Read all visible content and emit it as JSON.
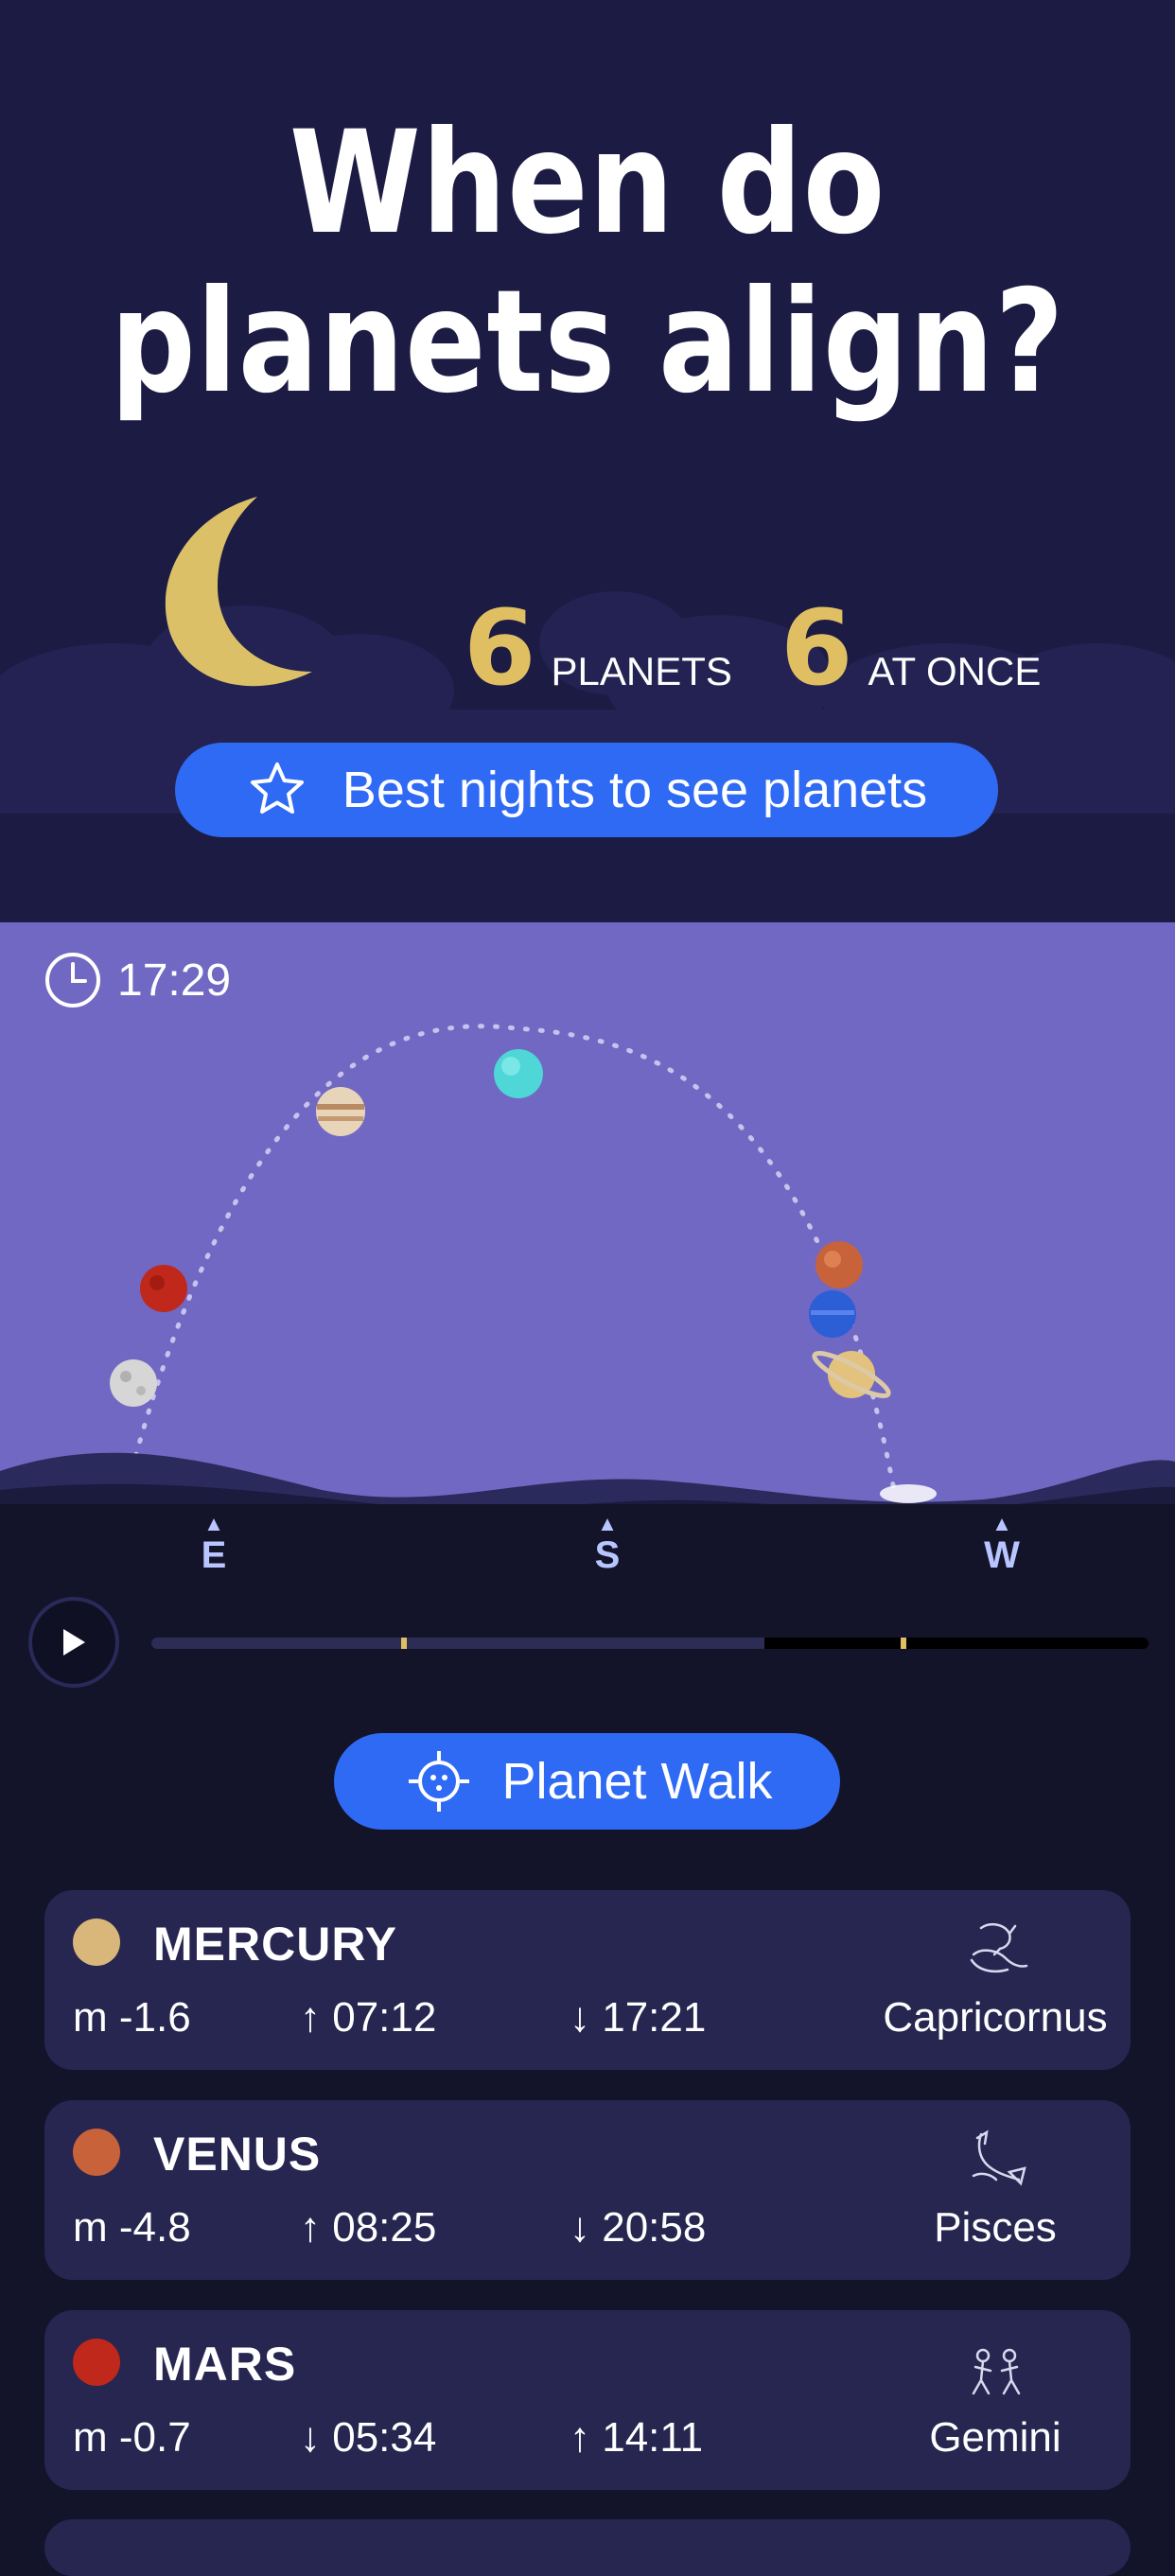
{
  "hero": {
    "title": "When do planets align?",
    "planets_count": "6",
    "planets_label": "PLANETS",
    "at_once_count": "6",
    "at_once_label": "AT ONCE",
    "best_nights_label": "Best nights to see planets"
  },
  "sky": {
    "time": "17:29",
    "compass": {
      "east": "E",
      "south": "S",
      "west": "W"
    }
  },
  "timeline": {
    "progress": 0.615
  },
  "planet_walk_label": "Planet Walk",
  "planets": [
    {
      "name": "MERCURY",
      "magnitude": "m -1.6",
      "time1": "↑ 07:12",
      "time2": "↓ 17:21",
      "constellation": "Capricornus",
      "color": "#d9b77a"
    },
    {
      "name": "VENUS",
      "magnitude": "m -4.8",
      "time1": "↑ 08:25",
      "time2": "↓ 20:58",
      "constellation": "Pisces",
      "color": "#c8623a"
    },
    {
      "name": "MARS",
      "magnitude": "m -0.7",
      "time1": "↓ 05:34",
      "time2": "↑ 14:11",
      "constellation": "Gemini",
      "color": "#c0281b"
    }
  ],
  "colors": {
    "accent": "#2f6af5",
    "hero_bg": "#1c1b44",
    "sky_bg": "#7168c3",
    "gold": "#e0bf62",
    "card_bg": "#262651"
  }
}
